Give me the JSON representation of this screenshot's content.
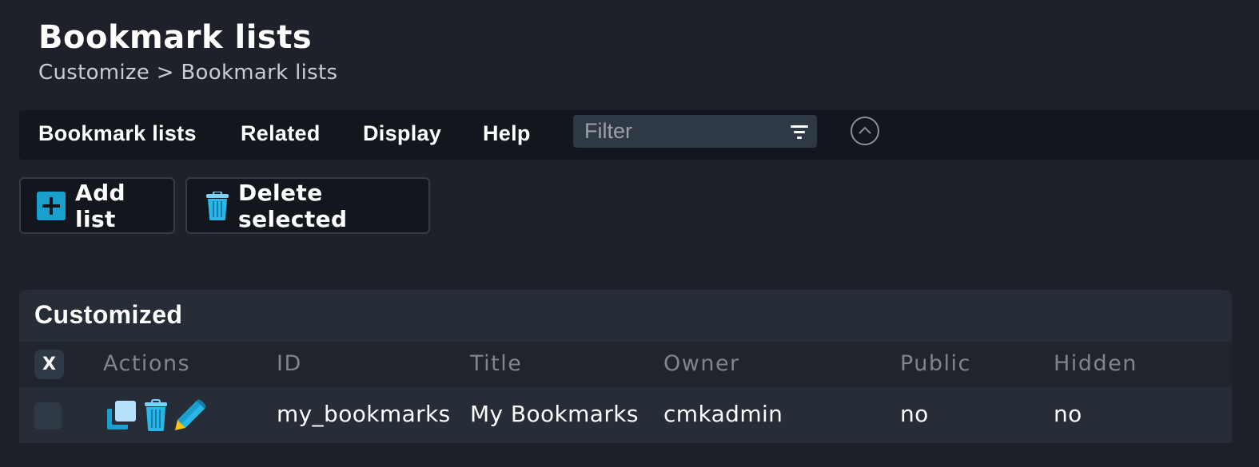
{
  "header": {
    "title": "Bookmark lists",
    "breadcrumb": "Customize > Bookmark lists"
  },
  "menubar": {
    "items": [
      {
        "label": "Bookmark lists"
      },
      {
        "label": "Related"
      },
      {
        "label": "Display"
      },
      {
        "label": "Help"
      }
    ],
    "filter": {
      "placeholder": "Filter",
      "value": ""
    },
    "icons": {
      "filter": "filter-icon",
      "collapse": "chevron-up-circle-icon"
    }
  },
  "toolbar": {
    "add_label": "Add list",
    "add_icon": "plus-icon",
    "delete_label": "Delete selected",
    "delete_icon": "trash-icon"
  },
  "table": {
    "title": "Customized",
    "select_all_label": "X",
    "columns": [
      "Actions",
      "ID",
      "Title",
      "Owner",
      "Public",
      "Hidden"
    ],
    "rows": [
      {
        "checked": false,
        "actions": [
          "clone-icon",
          "trash-icon",
          "edit-pencil-icon"
        ],
        "id": "my_bookmarks",
        "title": "My Bookmarks",
        "owner": "cmkadmin",
        "public": "no",
        "hidden": "no"
      }
    ]
  },
  "colors": {
    "background": "#1e2129",
    "menubar": "#12171e",
    "accent_blue": "#1a9fcf",
    "icon_light_blue": "#29b6e8",
    "pencil_tip": "#f5c518"
  }
}
